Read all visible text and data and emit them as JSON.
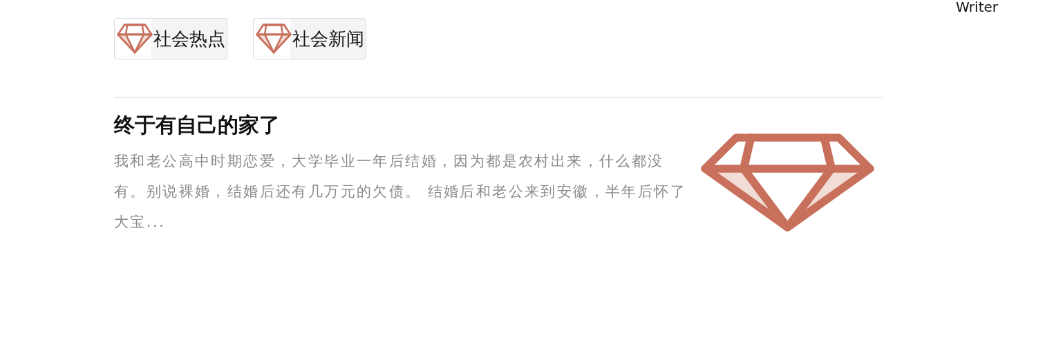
{
  "header": {
    "writer_link": "Writer"
  },
  "tags": [
    {
      "label": "社会热点"
    },
    {
      "label": "社会新闻"
    }
  ],
  "article": {
    "title": "终于有自己的家了",
    "excerpt": "我和老公高中时期恋爱，大学毕业一年后结婚，因为都是农村出来，什么都没有。别说裸婚，结婚后还有几万元的欠债。 结婚后和老公来到安徽，半年后怀了大宝..."
  }
}
